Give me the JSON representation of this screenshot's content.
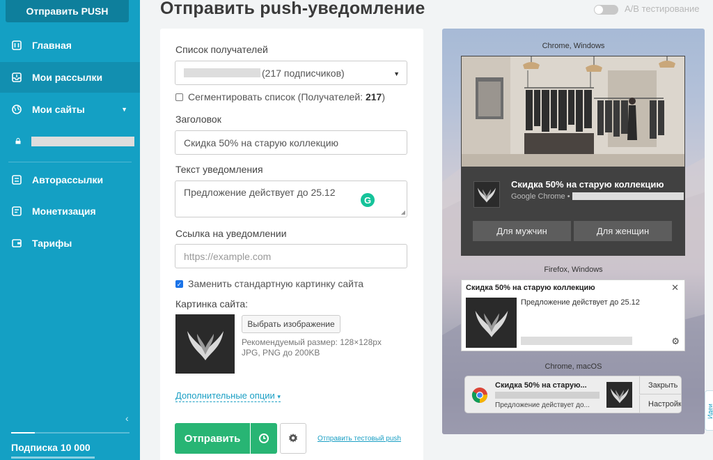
{
  "sidebar": {
    "push_button": "Отправить PUSH",
    "items": [
      {
        "label": "Главная",
        "icon": "dashboard-icon"
      },
      {
        "label": "Мои рассылки",
        "icon": "inbox-icon"
      },
      {
        "label": "Мои сайты",
        "icon": "globe-icon"
      },
      {
        "label": "Авторассылки",
        "icon": "auto-mail-icon"
      },
      {
        "label": "Монетизация",
        "icon": "monetization-icon"
      },
      {
        "label": "Тарифы",
        "icon": "wallet-icon"
      }
    ],
    "active_index": 1,
    "subscription": "Подписка 10 000"
  },
  "header": {
    "title": "Отправить push-уведомление",
    "ab_label": "A/B тестирование"
  },
  "form": {
    "recipients_label": "Список получателей",
    "recipients_value": "(217 подписчиков)",
    "segment_label": "Сегментировать список (Получателей: ",
    "segment_count": "217",
    "segment_suffix": ")",
    "title_label": "Заголовок",
    "title_value": "Скидка 50% на старую коллекцию",
    "text_label": "Текст уведомления",
    "text_value": "Предложение действует до 25.12",
    "link_label": "Ссылка на уведомлении",
    "link_placeholder": "https://example.com",
    "replace_image_label": "Заменить стандартную картинку сайта",
    "site_image_label": "Картинка сайта:",
    "choose_image": "Выбрать изображение",
    "hint_size": "Рекомендуемый размер: 128×128px",
    "hint_format": "JPG, PNG до 200KB",
    "more_options": "Дополнительные опции",
    "send": "Отправить",
    "test_push": "Отправить тестовый push"
  },
  "preview": {
    "chrome_windows_label": "Chrome, Windows",
    "firefox_windows_label": "Firefox, Windows",
    "chrome_mac_label": "Chrome, macOS",
    "title": "Скидка 50% на старую коллекцию",
    "title_truncated": "Скидка 50% на старую...",
    "body": "Предложение действует до 25.12",
    "body_truncated": "Предложение действует до...",
    "source": "Google Chrome •",
    "button_men": "Для мужчин",
    "button_women": "Для женщин",
    "mac_close": "Закрыть",
    "mac_settings": "Настройки",
    "side_tab": "Идеи"
  }
}
